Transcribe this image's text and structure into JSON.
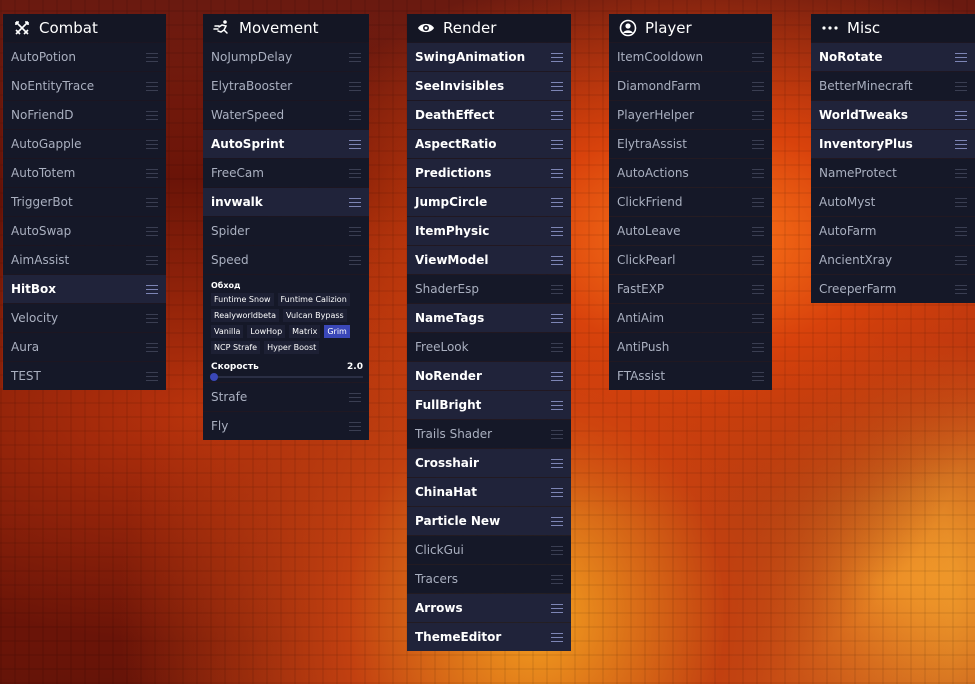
{
  "colors": {
    "panel_bg": "#151828",
    "enabled_bg": "#20233a",
    "accent": "#3a47b8",
    "disabled_text": "#aab0c0"
  },
  "combat": {
    "title": "Combat",
    "icon": "swords-icon",
    "modules": [
      {
        "label": "AutoPotion",
        "enabled": false
      },
      {
        "label": "NoEntityTrace",
        "enabled": false
      },
      {
        "label": "NoFriendD",
        "enabled": false
      },
      {
        "label": "AutoGapple",
        "enabled": false
      },
      {
        "label": "AutoTotem",
        "enabled": false
      },
      {
        "label": "TriggerBot",
        "enabled": false
      },
      {
        "label": "AutoSwap",
        "enabled": false
      },
      {
        "label": "AimAssist",
        "enabled": false
      },
      {
        "label": "HitBox",
        "enabled": true
      },
      {
        "label": "Velocity",
        "enabled": false
      },
      {
        "label": "Aura",
        "enabled": false
      },
      {
        "label": "TEST",
        "enabled": false
      }
    ]
  },
  "movement": {
    "title": "Movement",
    "icon": "running-icon",
    "modules_top": [
      {
        "label": "NoJumpDelay",
        "enabled": false
      },
      {
        "label": "ElytraBooster",
        "enabled": false
      },
      {
        "label": "WaterSpeed",
        "enabled": false
      },
      {
        "label": "AutoSprint",
        "enabled": true
      },
      {
        "label": "FreeCam",
        "enabled": false
      },
      {
        "label": "invwalk",
        "enabled": true
      },
      {
        "label": "Spider",
        "enabled": false
      },
      {
        "label": "Speed",
        "enabled": false
      }
    ],
    "speed_settings": {
      "mode_label": "Обход",
      "modes": [
        "Funtime Snow",
        "Funtime Calizion",
        "Realyworldbeta",
        "Vulcan Bypass",
        "Vanilla",
        "LowHop",
        "Matrix",
        "Grim",
        "NCP Strafe",
        "Hyper Boost"
      ],
      "selected_mode": "Grim",
      "slider_label": "Скорость",
      "slider_value": "2.0"
    },
    "modules_bottom": [
      {
        "label": "Strafe",
        "enabled": false
      },
      {
        "label": "Fly",
        "enabled": false
      }
    ]
  },
  "render": {
    "title": "Render",
    "icon": "eye-icon",
    "modules": [
      {
        "label": "SwingAnimation",
        "enabled": true
      },
      {
        "label": "SeeInvisibles",
        "enabled": true
      },
      {
        "label": "DeathEffect",
        "enabled": true
      },
      {
        "label": "AspectRatio",
        "enabled": true
      },
      {
        "label": "Predictions",
        "enabled": true
      },
      {
        "label": "JumpCircle",
        "enabled": true
      },
      {
        "label": "ItemPhysic",
        "enabled": true
      },
      {
        "label": "ViewModel",
        "enabled": true
      },
      {
        "label": "ShaderEsp",
        "enabled": false
      },
      {
        "label": "NameTags",
        "enabled": true
      },
      {
        "label": "FreeLook",
        "enabled": false
      },
      {
        "label": "NoRender",
        "enabled": true
      },
      {
        "label": "FullBright",
        "enabled": true
      },
      {
        "label": "Trails Shader",
        "enabled": false
      },
      {
        "label": "Crosshair",
        "enabled": true
      },
      {
        "label": "ChinaHat",
        "enabled": true
      },
      {
        "label": "Particle New",
        "enabled": true
      },
      {
        "label": "ClickGui",
        "enabled": false
      },
      {
        "label": "Tracers",
        "enabled": false
      },
      {
        "label": "Arrows",
        "enabled": true
      },
      {
        "label": "ThemeEditor",
        "enabled": true
      }
    ]
  },
  "player": {
    "title": "Player",
    "icon": "user-circle-icon",
    "modules": [
      {
        "label": "ItemCooldown",
        "enabled": false
      },
      {
        "label": "DiamondFarm",
        "enabled": false
      },
      {
        "label": "PlayerHelper",
        "enabled": false
      },
      {
        "label": "ElytraAssist",
        "enabled": false
      },
      {
        "label": "AutoActions",
        "enabled": false
      },
      {
        "label": "ClickFriend",
        "enabled": false
      },
      {
        "label": "AutoLeave",
        "enabled": false
      },
      {
        "label": "ClickPearl",
        "enabled": false
      },
      {
        "label": "FastEXP",
        "enabled": false
      },
      {
        "label": "AntiAim",
        "enabled": false
      },
      {
        "label": "AntiPush",
        "enabled": false
      },
      {
        "label": "FTAssist",
        "enabled": false
      }
    ]
  },
  "misc": {
    "title": "Misc",
    "icon": "more-dots-icon",
    "modules": [
      {
        "label": "NoRotate",
        "enabled": true
      },
      {
        "label": "BetterMinecraft",
        "enabled": false
      },
      {
        "label": "WorldTweaks",
        "enabled": true
      },
      {
        "label": "InventoryPlus",
        "enabled": true
      },
      {
        "label": "NameProtect",
        "enabled": false
      },
      {
        "label": "AutoMyst",
        "enabled": false
      },
      {
        "label": "AutoFarm",
        "enabled": false
      },
      {
        "label": "AncientXray",
        "enabled": false
      },
      {
        "label": "CreeperFarm",
        "enabled": false
      }
    ]
  }
}
